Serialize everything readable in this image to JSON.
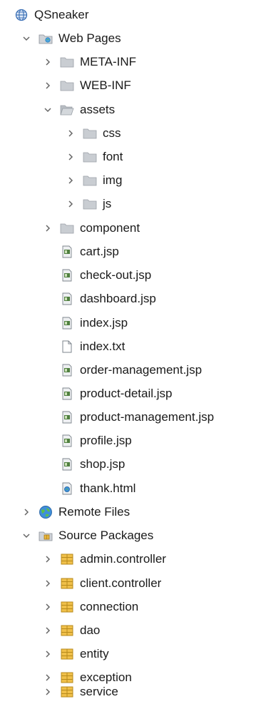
{
  "tree": {
    "project": "QSneaker",
    "web_pages": "Web Pages",
    "meta_inf": "META-INF",
    "web_inf": "WEB-INF",
    "assets": "assets",
    "css": "css",
    "font": "font",
    "img": "img",
    "js": "js",
    "component": "component",
    "files": [
      "cart.jsp",
      "check-out.jsp",
      "dashboard.jsp",
      "index.jsp",
      "index.txt",
      "order-management.jsp",
      "product-detail.jsp",
      "product-management.jsp",
      "profile.jsp",
      "shop.jsp",
      "thank.html"
    ],
    "remote_files": "Remote Files",
    "source_packages": "Source Packages",
    "packages": [
      "admin.controller",
      "client.controller",
      "connection",
      "dao",
      "entity",
      "exception",
      "service"
    ]
  }
}
